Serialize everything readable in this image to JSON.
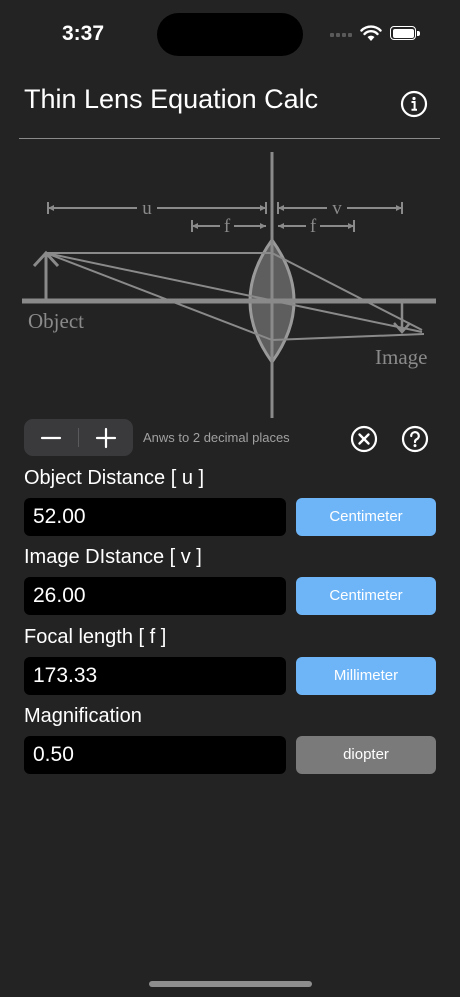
{
  "status": {
    "time": "3:37"
  },
  "header": {
    "title": "Thin Lens Equation Calc"
  },
  "diagram": {
    "label_u": "u",
    "label_v": "v",
    "label_f1": "f",
    "label_f2": "f",
    "label_object": "Object",
    "label_image": "Image"
  },
  "controls": {
    "decrement_symbol": "−",
    "increment_symbol": "+",
    "precision_label": "Anws to 2 decimal places"
  },
  "fields": [
    {
      "label": "Object Distance [ u ]",
      "value": "52.00",
      "unit": "Centimeter"
    },
    {
      "label": "Image DIstance [ v ]",
      "value": "26.00",
      "unit": "Centimeter"
    },
    {
      "label": "Focal length [ f ]",
      "value": "173.33",
      "unit": "Millimeter"
    },
    {
      "label": "Magnification",
      "value": "0.50",
      "unit": "diopter"
    }
  ],
  "colors": {
    "background": "#232323",
    "field_background": "#000000",
    "unit_active": "#6eb5f7",
    "unit_inactive": "#7a7a7a",
    "diagram_stroke": "#8a8a8a"
  }
}
